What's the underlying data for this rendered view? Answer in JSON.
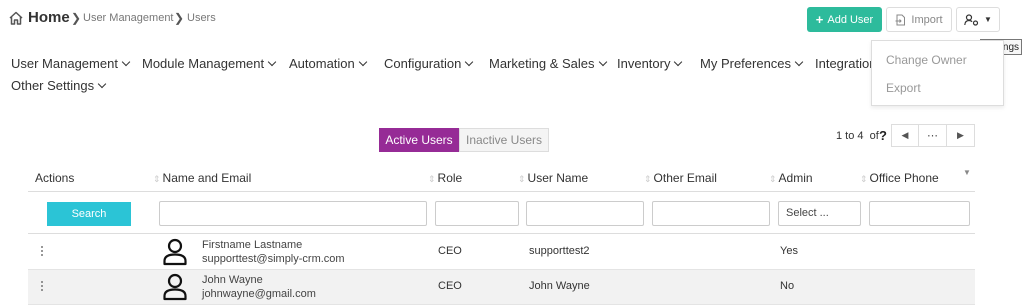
{
  "breadcrumb": {
    "home": "Home",
    "items": [
      "User Management",
      "Users"
    ]
  },
  "actions": {
    "add_user": "Add User",
    "import": "Import"
  },
  "settings_menu": {
    "tooltip": "Settings",
    "items": [
      "Change Owner",
      "Export"
    ]
  },
  "nav": {
    "items": [
      "User Management",
      "Module Management",
      "Automation",
      "Configuration",
      "Marketing & Sales",
      "Inventory",
      "My Preferences",
      "Integration",
      "Other Settings"
    ]
  },
  "tabs": {
    "active": "Active Users",
    "inactive": "Inactive Users"
  },
  "pagination": {
    "range": "1 to 4",
    "of": "of",
    "total": "?",
    "more": "⋯"
  },
  "table": {
    "columns": [
      "Actions",
      "Name and Email",
      "Role",
      "User Name",
      "Other Email",
      "Admin",
      "Office Phone"
    ],
    "search_label": "Search",
    "admin_filter": "Select ...",
    "rows": [
      {
        "name": "Firstname Lastname",
        "email": "supporttest@simply-crm.com",
        "role": "CEO",
        "username": "supporttest2",
        "admin": "Yes"
      },
      {
        "name": "John Wayne",
        "email": "johnwayne@gmail.com",
        "role": "CEO",
        "username": "John Wayne",
        "admin": "No"
      }
    ]
  },
  "colors": {
    "accent_green": "#2dbb9c",
    "tab_purple": "#962b96",
    "search_cyan": "#2bc4d6"
  }
}
